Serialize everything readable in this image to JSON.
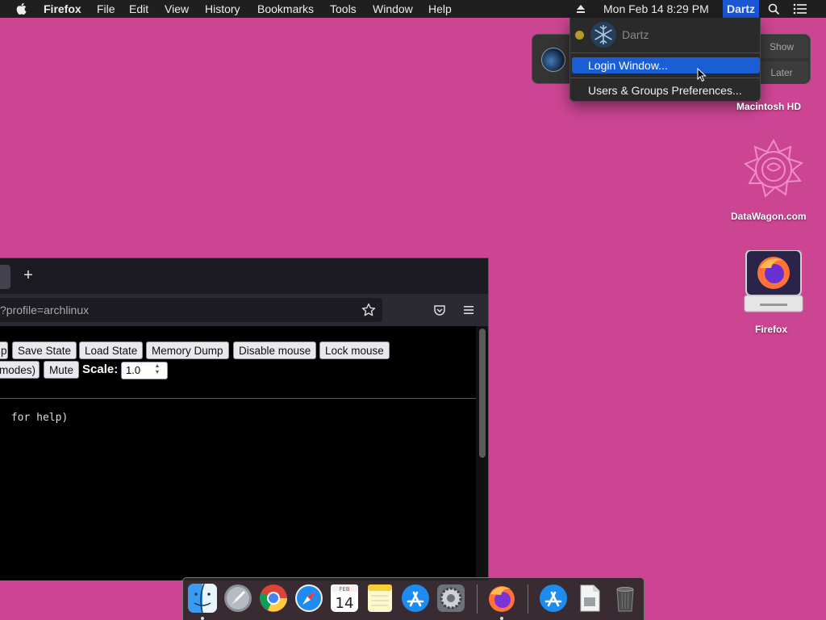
{
  "menubar": {
    "app_name": "Firefox",
    "menus": [
      "File",
      "Edit",
      "View",
      "History",
      "Bookmarks",
      "Tools",
      "Window",
      "Help"
    ],
    "clock": "Mon Feb 14  8:29 PM",
    "user": "Dartz"
  },
  "user_menu": {
    "username": "Dartz",
    "login_window": "Login Window...",
    "users_groups": "Users & Groups Preferences..."
  },
  "notification": {
    "show_label": "Show",
    "later_label": "Later"
  },
  "desktop": {
    "hd_label": "Macintosh HD",
    "datawagon_label": "DataWagon.com",
    "firefox_drive_label": "Firefox"
  },
  "browser": {
    "url": "?profile=archlinux",
    "new_tab_symbol": "+",
    "buttons": [
      "p",
      "Save State",
      "Load State",
      "Memory Dump",
      "Disable mouse",
      "Lock mouse"
    ],
    "buttons_row2": [
      "modes)",
      "Mute"
    ],
    "scale_label": "Scale:",
    "scale_value": "1.0",
    "terminal_line": " for help)"
  },
  "colors": {
    "desktop_bg": "#cc4593",
    "highlight": "#1a5ed6"
  }
}
